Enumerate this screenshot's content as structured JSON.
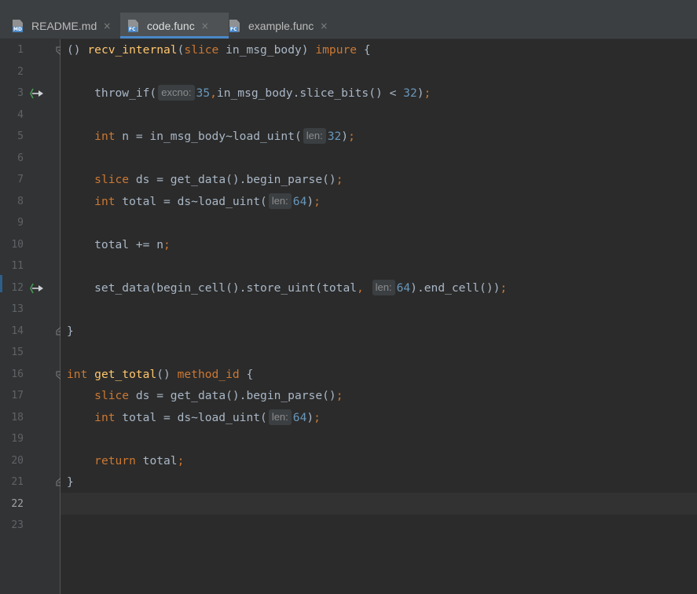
{
  "tabs": [
    {
      "label": "README.md",
      "icon": "markdown-file-icon",
      "badge": "MD",
      "active": false,
      "close": "×"
    },
    {
      "label": "code.func",
      "icon": "func-file-icon",
      "badge": "FC",
      "active": true,
      "close": "×"
    },
    {
      "label": "example.func",
      "icon": "func-file-icon",
      "badge": "FC",
      "active": false,
      "close": "×"
    }
  ],
  "editor": {
    "current_line": "22",
    "line_numbers": [
      "1",
      "2",
      "3",
      "4",
      "5",
      "6",
      "7",
      "8",
      "9",
      "10",
      "11",
      "12",
      "13",
      "14",
      "15",
      "16",
      "17",
      "18",
      "19",
      "20",
      "21",
      "22",
      "23"
    ],
    "lines": [
      [
        [
          "p",
          "()"
        ],
        [
          "t",
          " "
        ],
        [
          "fn",
          "recv_internal"
        ],
        [
          "p",
          "("
        ],
        [
          "kw",
          "slice"
        ],
        [
          "t",
          " in_msg_body) "
        ],
        [
          "kw",
          "impure"
        ],
        [
          "t",
          " {"
        ]
      ],
      [],
      [
        [
          "t",
          "    throw_if("
        ],
        [
          "hint",
          "excno:"
        ],
        [
          "num",
          "35"
        ],
        [
          "kw",
          ","
        ],
        [
          "t",
          "in_msg_body.slice_bits() < "
        ],
        [
          "num",
          "32"
        ],
        [
          "t",
          ")"
        ],
        [
          "kw",
          ";"
        ]
      ],
      [],
      [
        [
          "t",
          "    "
        ],
        [
          "kw",
          "int"
        ],
        [
          "t",
          " n = in_msg_body~load_uint("
        ],
        [
          "hint",
          "len:"
        ],
        [
          "num",
          "32"
        ],
        [
          "t",
          ")"
        ],
        [
          "kw",
          ";"
        ]
      ],
      [],
      [
        [
          "t",
          "    "
        ],
        [
          "kw",
          "slice"
        ],
        [
          "t",
          " ds = get_data().begin_parse()"
        ],
        [
          "kw",
          ";"
        ]
      ],
      [
        [
          "t",
          "    "
        ],
        [
          "kw",
          "int"
        ],
        [
          "t",
          " total = ds~load_uint("
        ],
        [
          "hint",
          "len:"
        ],
        [
          "num",
          "64"
        ],
        [
          "t",
          ")"
        ],
        [
          "kw",
          ";"
        ]
      ],
      [],
      [
        [
          "t",
          "    total += n"
        ],
        [
          "kw",
          ";"
        ]
      ],
      [],
      [
        [
          "t",
          "    set_data(begin_cell().store_uint(total"
        ],
        [
          "kw",
          ","
        ],
        [
          "t",
          " "
        ],
        [
          "hint",
          "len:"
        ],
        [
          "num",
          "64"
        ],
        [
          "t",
          ").end_cell())"
        ],
        [
          "kw",
          ";"
        ]
      ],
      [],
      [
        [
          "t",
          "}"
        ]
      ],
      [],
      [
        [
          "kw",
          "int"
        ],
        [
          "t",
          " "
        ],
        [
          "fn",
          "get_total"
        ],
        [
          "t",
          "() "
        ],
        [
          "kw",
          "method_id"
        ],
        [
          "t",
          " {"
        ]
      ],
      [
        [
          "t",
          "    "
        ],
        [
          "kw",
          "slice"
        ],
        [
          "t",
          " ds = get_data().begin_parse()"
        ],
        [
          "kw",
          ";"
        ]
      ],
      [
        [
          "t",
          "    "
        ],
        [
          "kw",
          "int"
        ],
        [
          "t",
          " total = ds~load_uint("
        ],
        [
          "hint",
          "len:"
        ],
        [
          "num",
          "64"
        ],
        [
          "t",
          ")"
        ],
        [
          "kw",
          ";"
        ]
      ],
      [],
      [
        [
          "t",
          "    "
        ],
        [
          "kw",
          "return"
        ],
        [
          "t",
          " total"
        ],
        [
          "kw",
          ";"
        ]
      ],
      [
        [
          "t",
          "}"
        ]
      ],
      [],
      []
    ]
  },
  "gutter": {
    "run_markers": [
      3,
      12
    ],
    "fold_open": [
      1,
      16
    ],
    "fold_close": [
      14,
      21
    ]
  },
  "colors": {
    "background": "#2b2b2b",
    "gutter": "#313335",
    "tab_bar": "#3c3f41",
    "keyword": "#cc7832",
    "function": "#ffc66d",
    "number": "#6897bb",
    "text": "#a9b7c6",
    "accent": "#4a88c7"
  }
}
